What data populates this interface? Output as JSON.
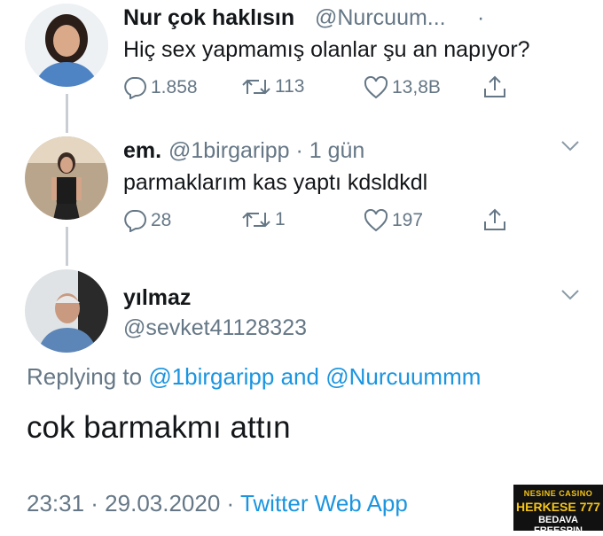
{
  "tweet1": {
    "name": "Nur çok haklısın",
    "handle": "@Nurcuum...",
    "dot": "·",
    "text": "Hiç sex yapmamış olanlar şu an napıyor?",
    "replies": "1.858",
    "retweets": "113",
    "likes": "13,8B"
  },
  "tweet2": {
    "name": "em.",
    "handle": "@1birgaripp · 1 gün",
    "text": "parmaklarım kas yaptı kdsldkdl",
    "replies": "28",
    "retweets": "1",
    "likes": "197"
  },
  "tweet3": {
    "name": "yılmaz",
    "handle": "@sevket41128323",
    "replying_prefix": "Replying to",
    "reply_user1": "@1birgaripp",
    "reply_and": "and",
    "reply_user2": "@Nurcuummm",
    "text": "cok barmakmı attın",
    "time": "23:31 · 29.03.2020 ·",
    "source": "Twitter Web App"
  },
  "ad": {
    "brand": "NESINE CASINO",
    "headline": "HERKESE 777",
    "subline": "BEDAVA FREESPIN"
  },
  "icons": [
    "reply-icon",
    "retweet-icon",
    "like-icon",
    "share-icon",
    "chevron-down-icon"
  ],
  "colors": {
    "text": "#14171a",
    "muted": "#657786",
    "link": "#1b95e0",
    "thread": "#c8ced4"
  }
}
